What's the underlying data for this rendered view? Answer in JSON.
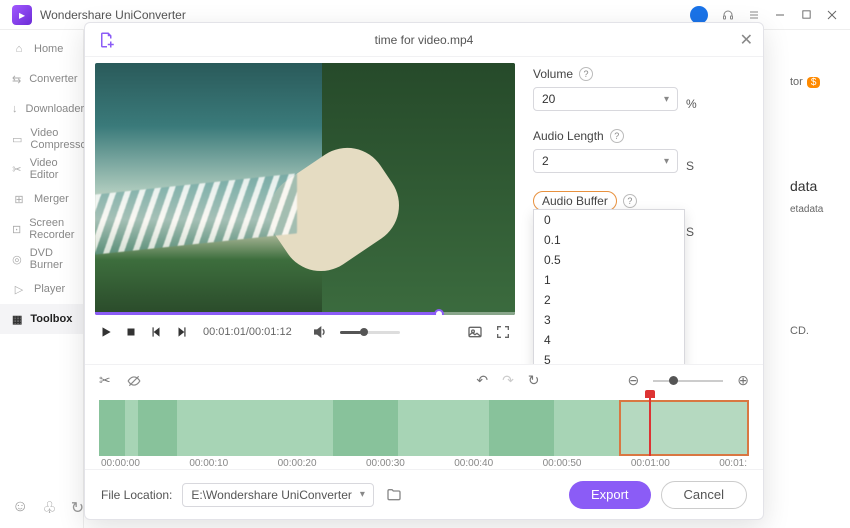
{
  "app": {
    "name": "Wondershare UniConverter"
  },
  "sidebar": {
    "items": [
      {
        "label": "Home"
      },
      {
        "label": "Converter"
      },
      {
        "label": "Downloader"
      },
      {
        "label": "Video Compressor"
      },
      {
        "label": "Video Editor"
      },
      {
        "label": "Merger"
      },
      {
        "label": "Screen Recorder"
      },
      {
        "label": "DVD Burner"
      },
      {
        "label": "Player"
      },
      {
        "label": "Toolbox"
      }
    ]
  },
  "peek": {
    "tor": "tor",
    "data": "data",
    "etadata": "etadata",
    "cd": "CD."
  },
  "modal": {
    "title": "time for video.mp4",
    "player": {
      "time": "00:01:01/00:01:12"
    },
    "controls": {
      "volume": {
        "label": "Volume",
        "value": "20",
        "unit": "%"
      },
      "audioLength": {
        "label": "Audio Length",
        "value": "2",
        "unit": "S"
      },
      "audioBuffer": {
        "label": "Audio Buffer",
        "value": "0.1",
        "unit": "S",
        "options": [
          "0",
          "0.1",
          "0.5",
          "1",
          "2",
          "3",
          "4",
          "5"
        ]
      }
    },
    "ruler": [
      "00:00:00",
      "00:00:10",
      "00:00:20",
      "00:00:30",
      "00:00:40",
      "00:00:50",
      "00:01:00",
      "00:01:"
    ],
    "footer": {
      "locLabel": "File Location:",
      "path": "E:\\Wondershare UniConverter",
      "export": "Export",
      "cancel": "Cancel"
    }
  }
}
